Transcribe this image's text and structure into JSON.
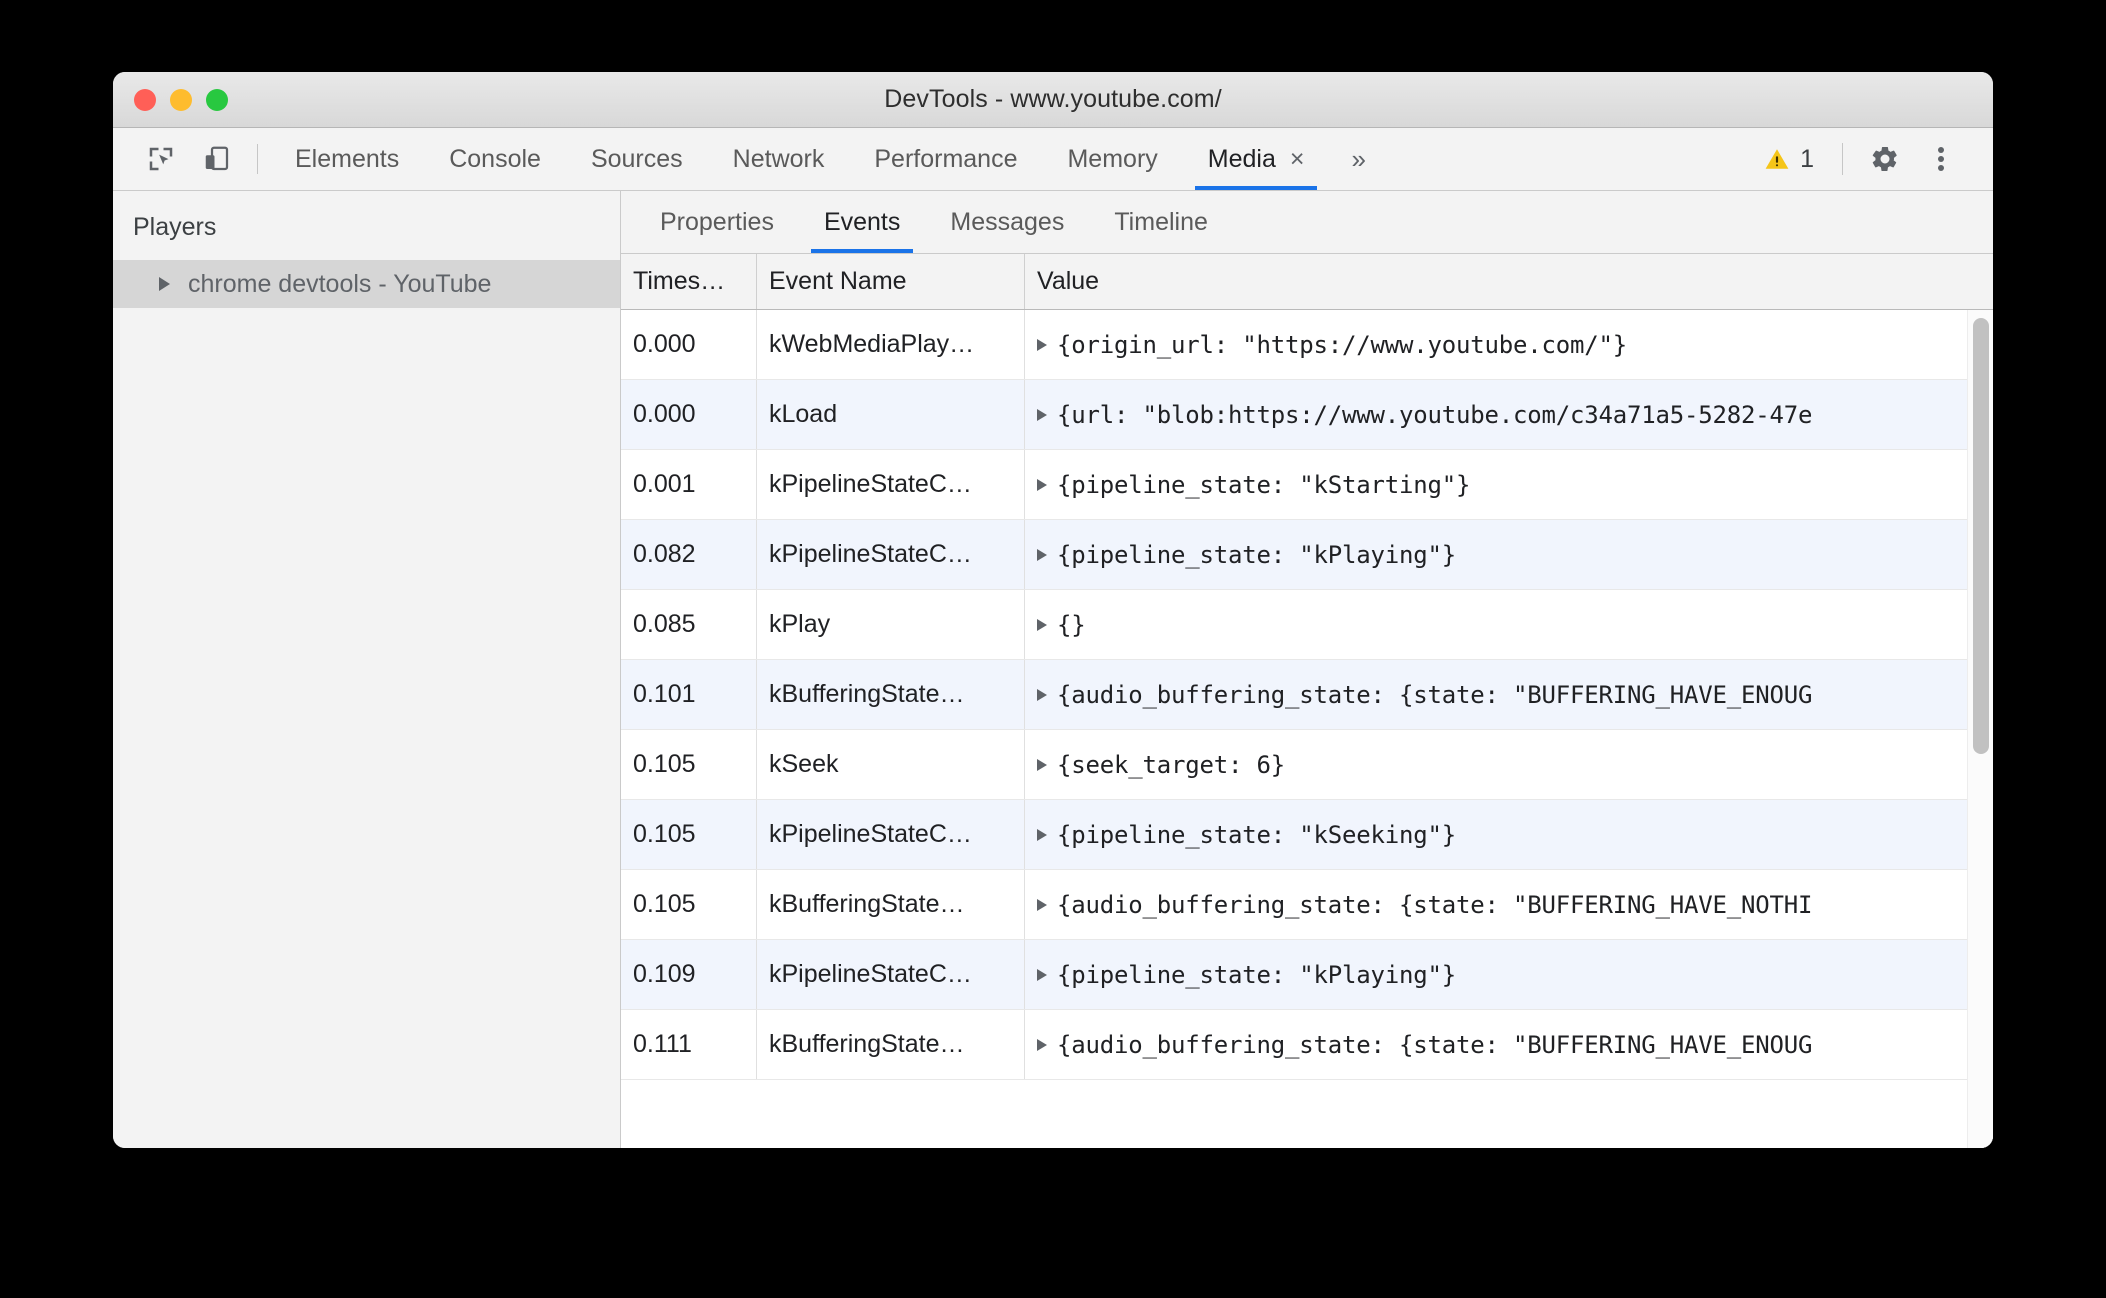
{
  "colors": {
    "accent": "#1a73e8",
    "warning": "#f5c518",
    "traffic_red": "#ff5f57",
    "traffic_yellow": "#febc2e",
    "traffic_green": "#28c840",
    "selected_row": "#d6d6d6",
    "alt_row": "#f1f5fd"
  },
  "window": {
    "title": "DevTools - www.youtube.com/"
  },
  "toolbar": {
    "inspect_icon": "inspect-element-icon",
    "device_icon": "device-toolbar-icon",
    "tabs": [
      {
        "label": "Elements",
        "active": false
      },
      {
        "label": "Console",
        "active": false
      },
      {
        "label": "Sources",
        "active": false
      },
      {
        "label": "Network",
        "active": false
      },
      {
        "label": "Performance",
        "active": false
      },
      {
        "label": "Memory",
        "active": false
      },
      {
        "label": "Media",
        "active": true,
        "closable": true
      }
    ],
    "close_glyph": "×",
    "overflow_glyph": "»",
    "warning_count": "1",
    "warning_icon": "warning-triangle-icon",
    "settings_icon": "gear-icon",
    "more_icon": "kebab-menu-icon"
  },
  "sidebar": {
    "header": "Players",
    "items": [
      {
        "label": "chrome devtools - YouTube",
        "selected": true,
        "expanded": false
      }
    ]
  },
  "panel": {
    "subtabs": [
      {
        "label": "Properties",
        "active": false
      },
      {
        "label": "Events",
        "active": true
      },
      {
        "label": "Messages",
        "active": false
      },
      {
        "label": "Timeline",
        "active": false
      }
    ]
  },
  "table": {
    "columns": [
      "Times…",
      "Event Name",
      "Value"
    ],
    "rows": [
      {
        "timestamp": "0.000",
        "event": "kWebMediaPlay…",
        "value": "{origin_url: \"https://www.youtube.com/\"}",
        "expandable": true,
        "scrollbar": false
      },
      {
        "timestamp": "0.000",
        "event": "kLoad",
        "value": "{url: \"blob:https://www.youtube.com/c34a71a5-5282-47e",
        "expandable": true,
        "scrollbar": true,
        "scroll_thumb_percent": 72
      },
      {
        "timestamp": "0.001",
        "event": "kPipelineStateC…",
        "value": "{pipeline_state: \"kStarting\"}",
        "expandable": true,
        "scrollbar": false
      },
      {
        "timestamp": "0.082",
        "event": "kPipelineStateC…",
        "value": "{pipeline_state: \"kPlaying\"}",
        "expandable": true,
        "scrollbar": false
      },
      {
        "timestamp": "0.085",
        "event": "kPlay",
        "value": "{}",
        "expandable": true,
        "scrollbar": false
      },
      {
        "timestamp": "0.101",
        "event": "kBufferingState…",
        "value": "{audio_buffering_state: {state: \"BUFFERING_HAVE_ENOUG",
        "expandable": true,
        "scrollbar": true,
        "scroll_thumb_percent": 94
      },
      {
        "timestamp": "0.105",
        "event": "kSeek",
        "value": "{seek_target: 6}",
        "expandable": true,
        "scrollbar": false
      },
      {
        "timestamp": "0.105",
        "event": "kPipelineStateC…",
        "value": "{pipeline_state: \"kSeeking\"}",
        "expandable": true,
        "scrollbar": false
      },
      {
        "timestamp": "0.105",
        "event": "kBufferingState…",
        "value": "{audio_buffering_state: {state: \"BUFFERING_HAVE_NOTHI",
        "expandable": true,
        "scrollbar": true,
        "scroll_thumb_percent": 92
      },
      {
        "timestamp": "0.109",
        "event": "kPipelineStateC…",
        "value": "{pipeline_state: \"kPlaying\"}",
        "expandable": true,
        "scrollbar": false
      },
      {
        "timestamp": "0.111",
        "event": "kBufferingState…",
        "value": "{audio_buffering_state: {state: \"BUFFERING_HAVE_ENOUG",
        "expandable": true,
        "scrollbar": false
      }
    ],
    "vertical_scroll": {
      "top_percent": 0,
      "thumb_percent": 52
    }
  }
}
